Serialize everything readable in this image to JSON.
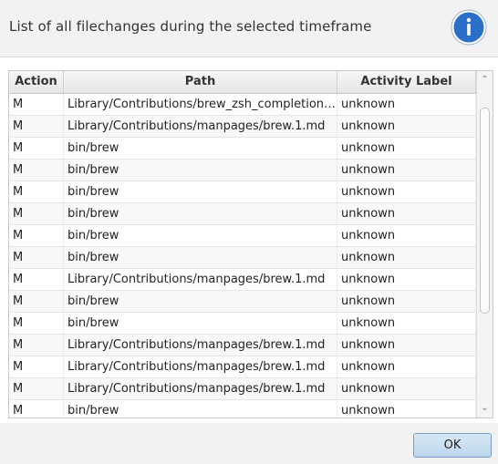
{
  "dialog": {
    "title": "List of all filechanges during the selected timeframe",
    "info_icon": "info-icon",
    "accent_color": "#2a6fc9"
  },
  "table": {
    "columns": [
      "Action",
      "Path",
      "Activity Label"
    ],
    "rows": [
      {
        "action": "M",
        "path": "Library/Contributions/brew_zsh_completion.zsh",
        "label": "unknown"
      },
      {
        "action": "M",
        "path": "Library/Contributions/manpages/brew.1.md",
        "label": "unknown"
      },
      {
        "action": "M",
        "path": "bin/brew",
        "label": "unknown"
      },
      {
        "action": "M",
        "path": "bin/brew",
        "label": "unknown"
      },
      {
        "action": "M",
        "path": "bin/brew",
        "label": "unknown"
      },
      {
        "action": "M",
        "path": "bin/brew",
        "label": "unknown"
      },
      {
        "action": "M",
        "path": "bin/brew",
        "label": "unknown"
      },
      {
        "action": "M",
        "path": "bin/brew",
        "label": "unknown"
      },
      {
        "action": "M",
        "path": "Library/Contributions/manpages/brew.1.md",
        "label": "unknown"
      },
      {
        "action": "M",
        "path": "bin/brew",
        "label": "unknown"
      },
      {
        "action": "M",
        "path": "bin/brew",
        "label": "unknown"
      },
      {
        "action": "M",
        "path": "Library/Contributions/manpages/brew.1.md",
        "label": "unknown"
      },
      {
        "action": "M",
        "path": "Library/Contributions/manpages/brew.1.md",
        "label": "unknown"
      },
      {
        "action": "M",
        "path": "Library/Contributions/manpages/brew.1.md",
        "label": "unknown"
      },
      {
        "action": "M",
        "path": "bin/brew",
        "label": "unknown"
      }
    ]
  },
  "footer": {
    "ok_label": "OK"
  }
}
